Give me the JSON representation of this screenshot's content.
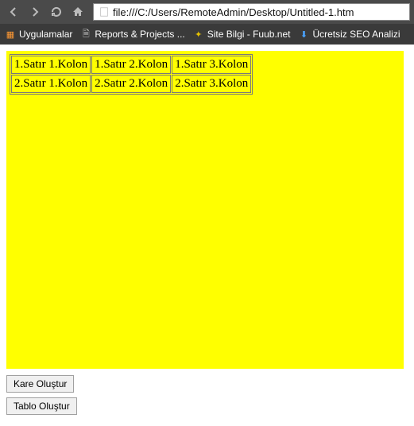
{
  "browser": {
    "url": "file:///C:/Users/RemoteAdmin/Desktop/Untitled-1.htm"
  },
  "bookmarks": [
    {
      "label": "Uygulamalar",
      "icon": "grid"
    },
    {
      "label": "Reports & Projects ...",
      "icon": "doc"
    },
    {
      "label": "Site Bilgi - Fuub.net",
      "icon": "yellow"
    },
    {
      "label": "Ücretsiz SEO Analizi",
      "icon": "blue"
    }
  ],
  "table": {
    "rows": [
      [
        "1.Satır 1.Kolon",
        "1.Satır 2.Kolon",
        "1.Satır 3.Kolon"
      ],
      [
        "2.Satır 1.Kolon",
        "2.Satır 2.Kolon",
        "2.Satır 3.Kolon"
      ]
    ]
  },
  "buttons": {
    "kare": "Kare Oluştur",
    "tablo": "Tablo Oluştur"
  }
}
